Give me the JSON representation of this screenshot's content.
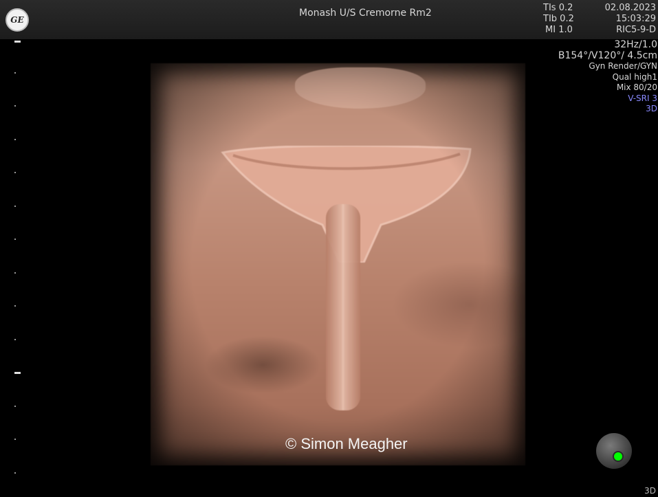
{
  "header": {
    "logo_text": "GE",
    "site": "Monash U/S Cremorne Rm2",
    "indices": [
      {
        "label": "TIs",
        "value": "0.2"
      },
      {
        "label": "TIb",
        "value": "0.2"
      },
      {
        "label": "MI",
        "value": "1.0"
      }
    ],
    "date": "02.08.2023",
    "time": "15:03:29",
    "probe": "RIC5-9-D"
  },
  "params": {
    "frame_rate": "32Hz/1.0",
    "geometry": "B154°/V120°/ 4.5cm",
    "render": "Gyn Render/GYN",
    "quality": "Qual high1",
    "mix": "Mix 80/20",
    "vsri": "V-SRI 3",
    "mode": "3D"
  },
  "watermark": "© Simon Meagher",
  "corner_label": "3D"
}
